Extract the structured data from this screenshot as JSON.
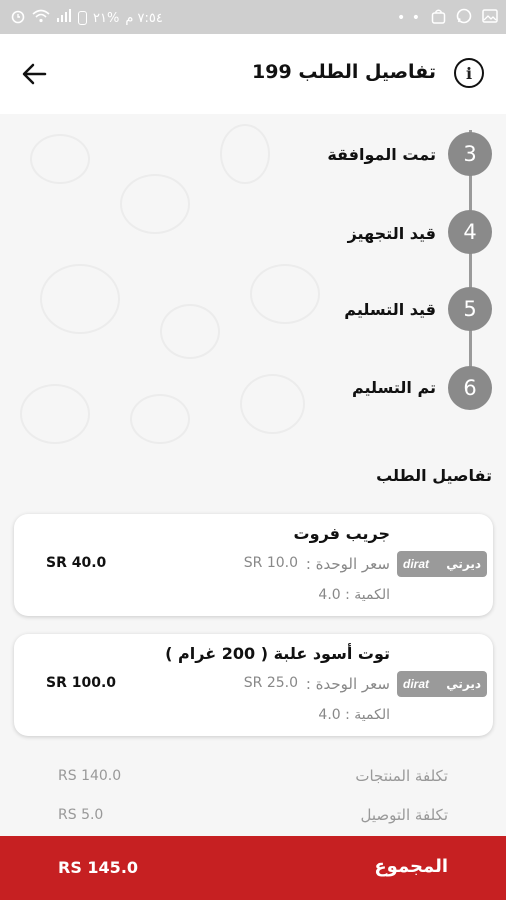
{
  "status_bar": {
    "time": "٧:٥٤ م",
    "battery": "%٢١",
    "dots": "• •"
  },
  "header": {
    "title": "تفاصيل الطلب 199",
    "info_glyph": "i",
    "back_icon": "arrow-left-icon"
  },
  "steps": [
    {
      "number": "3",
      "label": "تمت الموافقة"
    },
    {
      "number": "4",
      "label": "قيد التجهيز"
    },
    {
      "number": "5",
      "label": "قيد التسليم"
    },
    {
      "number": "6",
      "label": "تم التسليم"
    }
  ],
  "order_section_title": "تفاصيل الطلب",
  "items": [
    {
      "name": "جريب فروت",
      "brand_ar": "ديرتي",
      "brand_en": "dirat",
      "unit_label": "سعر الوحدة :",
      "unit_price": "SR 10.0",
      "quantity": "الكمية : 4.0",
      "total": "SR 40.0"
    },
    {
      "name": "توت أسود علبة ( 200 غرام )",
      "brand_ar": "ديرتي",
      "brand_en": "dirat",
      "unit_label": "سعر الوحدة :",
      "unit_price": "SR 25.0",
      "quantity": "الكمية : 4.0",
      "total": "SR 100.0"
    }
  ],
  "summary": {
    "products_cost_label": "تكلفة المنتجات",
    "products_cost_value": "RS 140.0",
    "delivery_cost_label": "تكلفة التوصيل",
    "delivery_cost_value": "RS 5.0"
  },
  "footer": {
    "label": "المجموع",
    "value": "RS 145.0"
  },
  "colors": {
    "accent": "#c62022",
    "step_circle": "#8a8a8a"
  }
}
